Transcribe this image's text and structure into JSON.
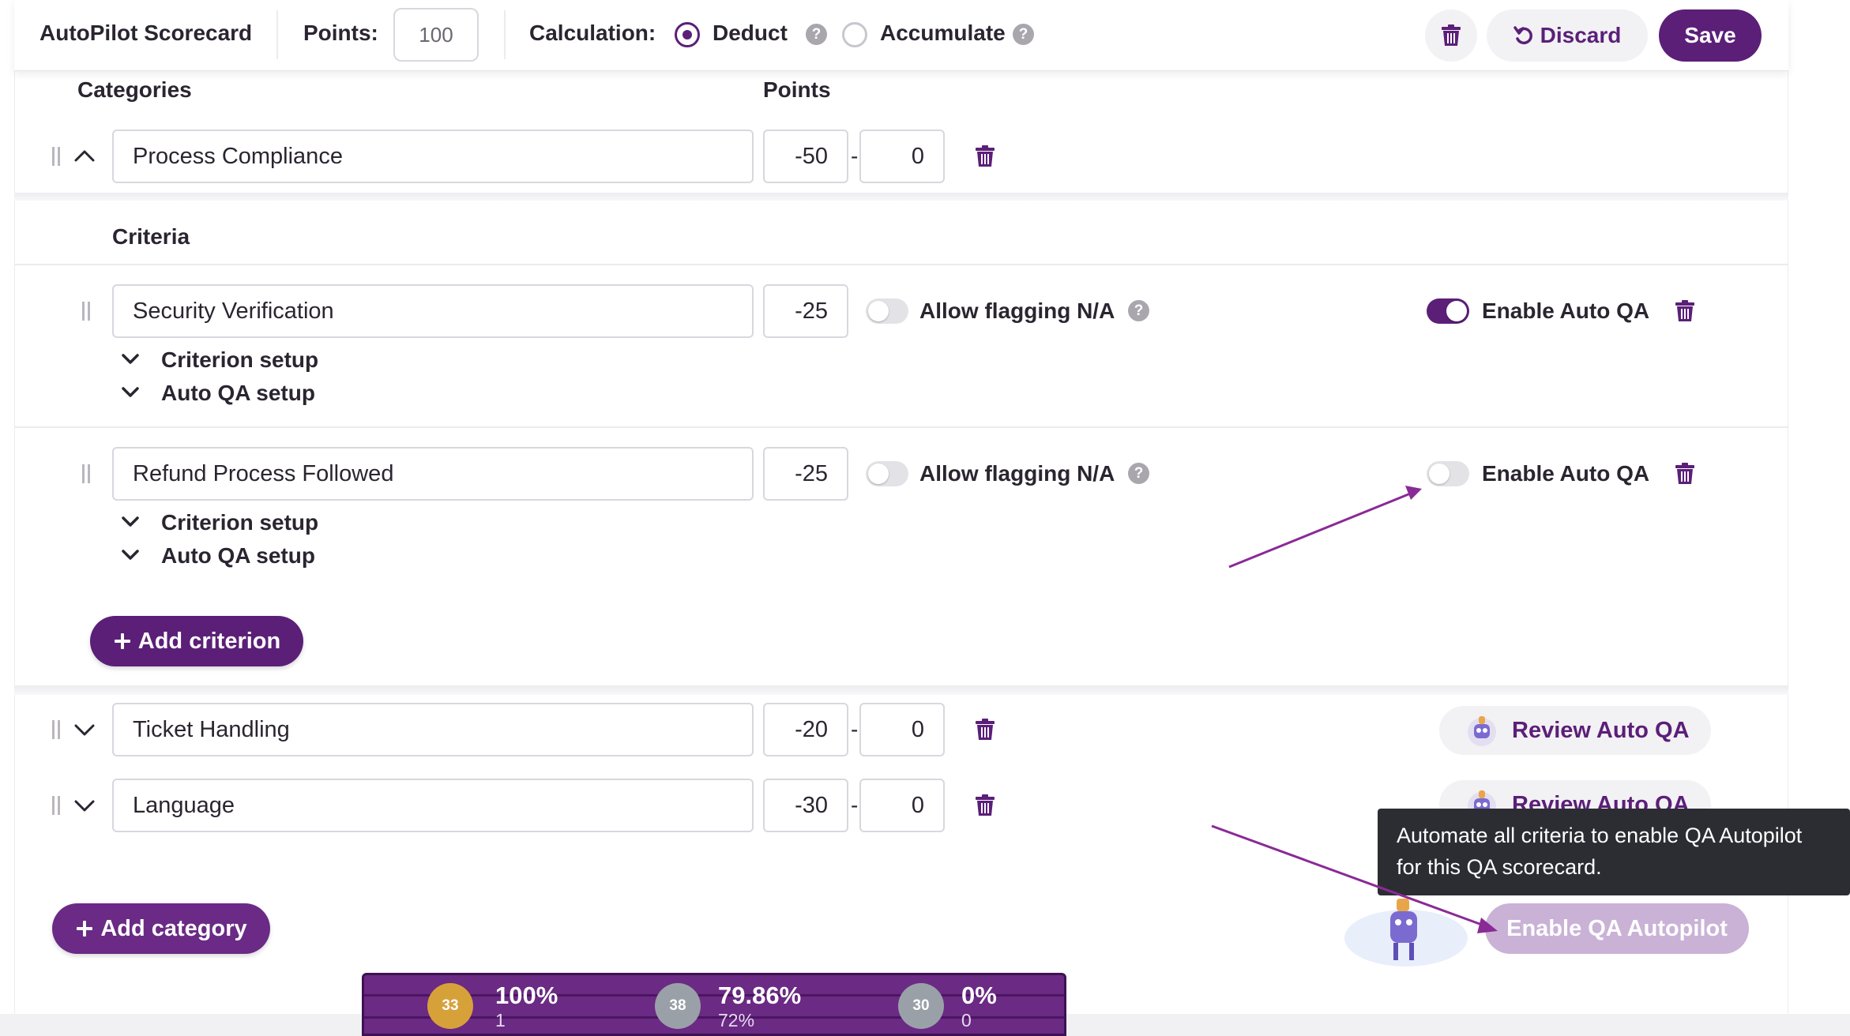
{
  "header": {
    "title": "AutoPilot Scorecard",
    "points_label": "Points:",
    "points_value": "100",
    "calculation_label": "Calculation:",
    "deduct_label": "Deduct",
    "accumulate_label": "Accumulate",
    "help_glyph": "?",
    "discard_label": "Discard",
    "save_label": "Save",
    "calculation_selected": "Deduct"
  },
  "columns": {
    "categories": "Categories",
    "points": "Points"
  },
  "categories": [
    {
      "name": "Process Compliance",
      "min": "-50",
      "max": "0",
      "expanded": true,
      "criteria_heading": "Criteria",
      "criteria": [
        {
          "name": "Security Verification",
          "points": "-25",
          "allow_na_label": "Allow flagging N/A",
          "allow_na": false,
          "auto_qa_label": "Enable Auto QA",
          "auto_qa": true,
          "setup_label": "Criterion setup",
          "auto_setup_label": "Auto QA setup"
        },
        {
          "name": "Refund Process Followed",
          "points": "-25",
          "allow_na_label": "Allow flagging N/A",
          "allow_na": false,
          "auto_qa_label": "Enable Auto QA",
          "auto_qa": false,
          "setup_label": "Criterion setup",
          "auto_setup_label": "Auto QA setup"
        }
      ],
      "add_criterion_label": "Add criterion"
    },
    {
      "name": "Ticket Handling",
      "min": "-20",
      "max": "0",
      "expanded": false,
      "review_label": "Review Auto QA"
    },
    {
      "name": "Language",
      "min": "-30",
      "max": "0",
      "expanded": false,
      "review_label": "Review Auto QA"
    }
  ],
  "range_separator": "-",
  "add_category_label": "Add category",
  "autopilot": {
    "button_label": "Enable QA Autopilot",
    "tooltip": "Automate all criteria to enable QA Autopilot for this QA scorecard."
  },
  "leaderboard": [
    {
      "badge": "33",
      "percent": "100%",
      "count": "1",
      "medal_color": "#d7a13a"
    },
    {
      "badge": "38",
      "percent": "79.86%",
      "count": "72%",
      "medal_color": "#9aa0a8"
    },
    {
      "badge": "30",
      "percent": "0%",
      "count": "0",
      "medal_color": "#9aa0a8"
    }
  ],
  "colors": {
    "brand": "#5b1f78",
    "annotation_arrow": "#8a2a96"
  },
  "icons": [
    "trash-icon",
    "undo-icon",
    "drag-handle-icon",
    "chevron-up-icon",
    "chevron-down-icon",
    "help-icon",
    "plus-icon",
    "robot-icon",
    "medal-icon"
  ]
}
